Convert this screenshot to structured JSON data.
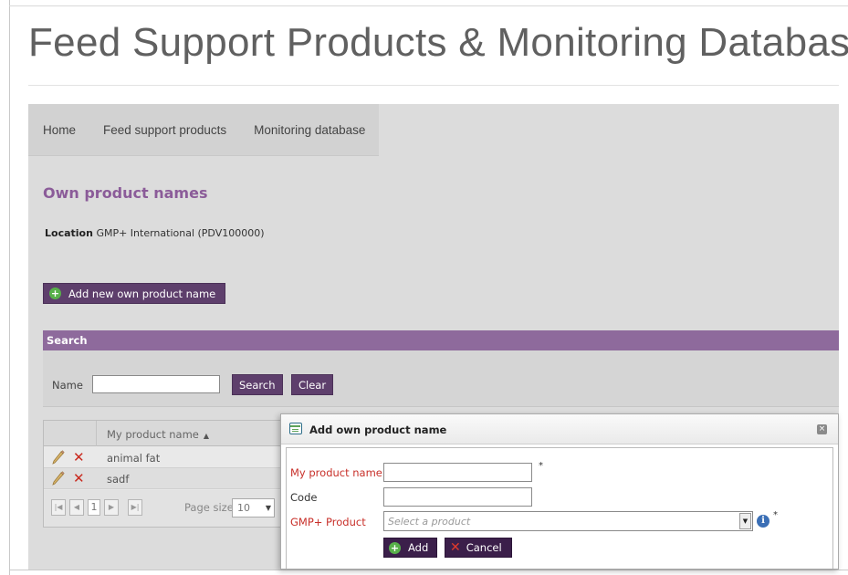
{
  "site_title": "Feed Support Products & Monitoring Database",
  "nav": {
    "items": [
      {
        "label": "Home"
      },
      {
        "label": "Feed support products"
      },
      {
        "label": "Monitoring database"
      }
    ]
  },
  "page": {
    "heading": "Own product names",
    "location_label": "Location",
    "location_value": "GMP+ International (PDV100000)",
    "add_new_label": "Add new own product name"
  },
  "search": {
    "bar_title": "Search",
    "name_label": "Name",
    "name_value": "",
    "search_button": "Search",
    "clear_button": "Clear"
  },
  "grid": {
    "column_header": "My product name",
    "sort_icon": "sort-ascending-icon",
    "rows": [
      {
        "name": "animal fat"
      },
      {
        "name": "sadf"
      }
    ],
    "pager": {
      "current_page": "1",
      "page_size_label": "Page size:",
      "page_size_value": "10"
    }
  },
  "dialog": {
    "title": "Add own product name",
    "fields": {
      "product_name_label": "My product name",
      "code_label": "Code",
      "gmp_product_label": "GMP+ Product",
      "gmp_product_placeholder": "Select a product",
      "required_marker": "*"
    },
    "add_button": "Add",
    "cancel_button": "Cancel"
  },
  "colors": {
    "accent_purple": "#8b5c99",
    "button_purple": "#5e3f6c",
    "search_bar": "#8e6a9c",
    "required_red": "#c8302a",
    "delete_red": "#c92a1f",
    "add_green": "#58b04a"
  }
}
